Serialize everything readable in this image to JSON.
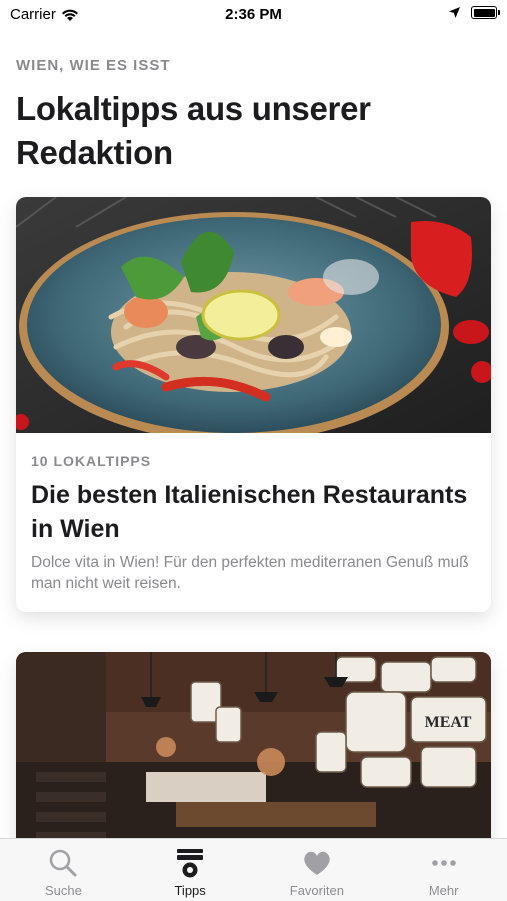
{
  "status_bar": {
    "carrier": "Carrier",
    "time": "2:36 PM"
  },
  "kicker": "WIEN, WIE ES ISST",
  "title": "Lokaltipps aus unserer Redaktion",
  "cards": [
    {
      "kicker": "10 LOKALTIPPS",
      "title": "Die besten Italienischen Restaurants in Wien",
      "description": "Dolce vita in Wien! Für den perfekten mediterranen Genuß muß man nicht weit reisen."
    },
    {
      "image_sign": "MEAT"
    }
  ],
  "tab_bar": {
    "tabs": [
      {
        "label": "Suche",
        "icon": "search-icon"
      },
      {
        "label": "Tipps",
        "icon": "tips-icon",
        "active": true
      },
      {
        "label": "Favoriten",
        "icon": "heart-icon"
      },
      {
        "label": "Mehr",
        "icon": "more-icon"
      }
    ]
  }
}
